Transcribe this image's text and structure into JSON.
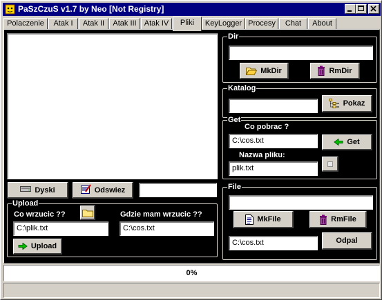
{
  "window": {
    "title": "PaSzCzuS v1.7 by Neo [Not Registry]"
  },
  "tabs": [
    "Polaczenie",
    "Atak I",
    "Atak II",
    "Atak III",
    "Atak IV",
    "Pliki",
    "KeyLogger",
    "Procesy",
    "Chat",
    "About"
  ],
  "active_tab": "Pliki",
  "left": {
    "dyski_label": "Dyski",
    "odswiez_label": "Odswiez",
    "path_value": ""
  },
  "upload": {
    "title": "Upload",
    "source_label": "Co wrzucic ??",
    "source_value": "C:\\plik.txt",
    "dest_label": "Gdzie mam wrzucic ??",
    "dest_value": "C:\\cos.txt",
    "button_label": "Upload"
  },
  "dir": {
    "title": "Dir",
    "value": "",
    "mkdir_label": "MkDir",
    "rmdir_label": "RmDir"
  },
  "katalog": {
    "title": "Katalog",
    "value": "",
    "pokaz_label": "Pokaz"
  },
  "get": {
    "title": "Get",
    "source_label": "Co pobrac ?",
    "source_value": "C:\\cos.txt",
    "name_label": "Nazwa pliku:",
    "name_value": "plik.txt",
    "button_label": "Get"
  },
  "file": {
    "title": "File",
    "value": "",
    "mkfile_label": "MkFile",
    "rmfile_label": "RmFile",
    "open_value": "C:\\cos.txt",
    "odpal_label": "Odpal"
  },
  "progress": {
    "text": "0%",
    "fraction": 0
  },
  "colors": {
    "titlebar": "#000080",
    "panel": "#000000",
    "face": "#d4d0c8"
  }
}
